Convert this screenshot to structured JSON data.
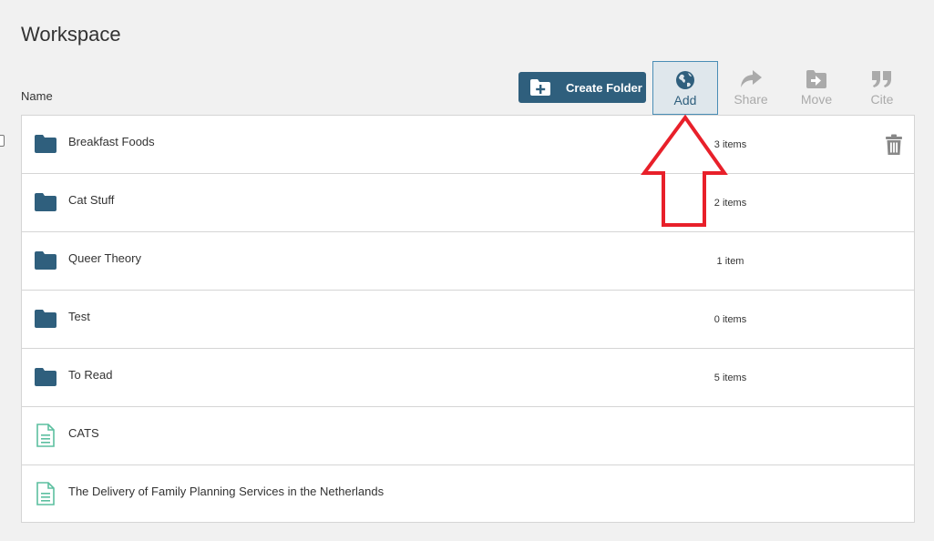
{
  "page": {
    "title": "Workspace",
    "name_header": "Name"
  },
  "toolbar": {
    "create_folder_label": "Create Folder",
    "add_label": "Add",
    "share_label": "Share",
    "move_label": "Move",
    "cite_label": "Cite"
  },
  "items": [
    {
      "type": "folder",
      "name": "Breakfast Foods",
      "count": "3 items"
    },
    {
      "type": "folder",
      "name": "Cat Stuff",
      "count": "2 items"
    },
    {
      "type": "folder",
      "name": "Queer Theory",
      "count": "1 item"
    },
    {
      "type": "folder",
      "name": "Test",
      "count": "0 items"
    },
    {
      "type": "folder",
      "name": "To Read",
      "count": "5 items"
    },
    {
      "type": "document",
      "name": "CATS",
      "count": ""
    },
    {
      "type": "document",
      "name": "The Delivery of Family Planning Services in the Netherlands",
      "count": ""
    }
  ],
  "icons": {
    "create_folder": "folder-plus-icon",
    "add": "globe-icon",
    "share": "share-arrow-icon",
    "move": "move-folder-icon",
    "cite": "quote-icon",
    "folder": "folder-icon",
    "document": "document-icon",
    "delete": "trash-icon"
  },
  "colors": {
    "primary": "#2f5f7d",
    "folder": "#2f5f7d",
    "document": "#5bbf9f",
    "disabled": "#aaaaaa",
    "annotation_arrow": "#e8202a"
  }
}
